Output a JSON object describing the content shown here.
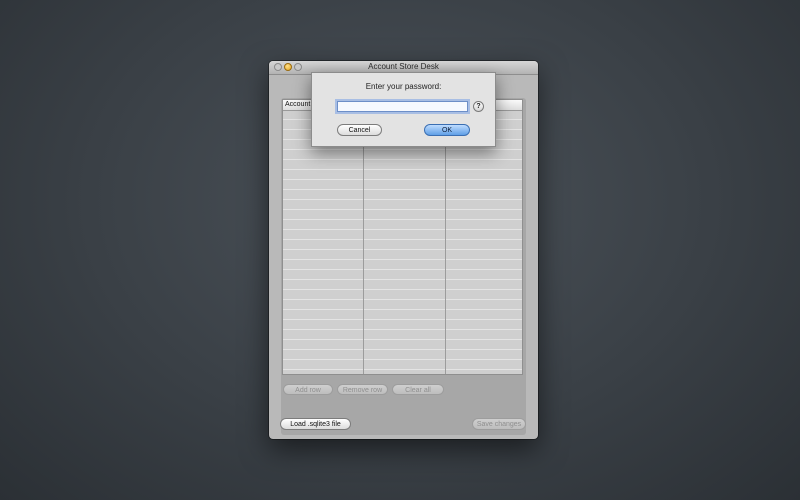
{
  "window": {
    "title": "Account Store Desk"
  },
  "table": {
    "columns": [
      "Account",
      "",
      ""
    ]
  },
  "actions": {
    "add_row": "Add row",
    "remove_row": "Remove row",
    "clear_all": "Clear all",
    "load_file": "Load .sqlite3 file",
    "save_changes": "Save changes"
  },
  "password_sheet": {
    "prompt": "Enter your password:",
    "password_value": "",
    "help_label": "?",
    "cancel_label": "Cancel",
    "ok_label": "OK"
  },
  "colors": {
    "desktop": "#3a4046",
    "window": "#b9b9b9",
    "ok_button": "#5f9fe6"
  }
}
